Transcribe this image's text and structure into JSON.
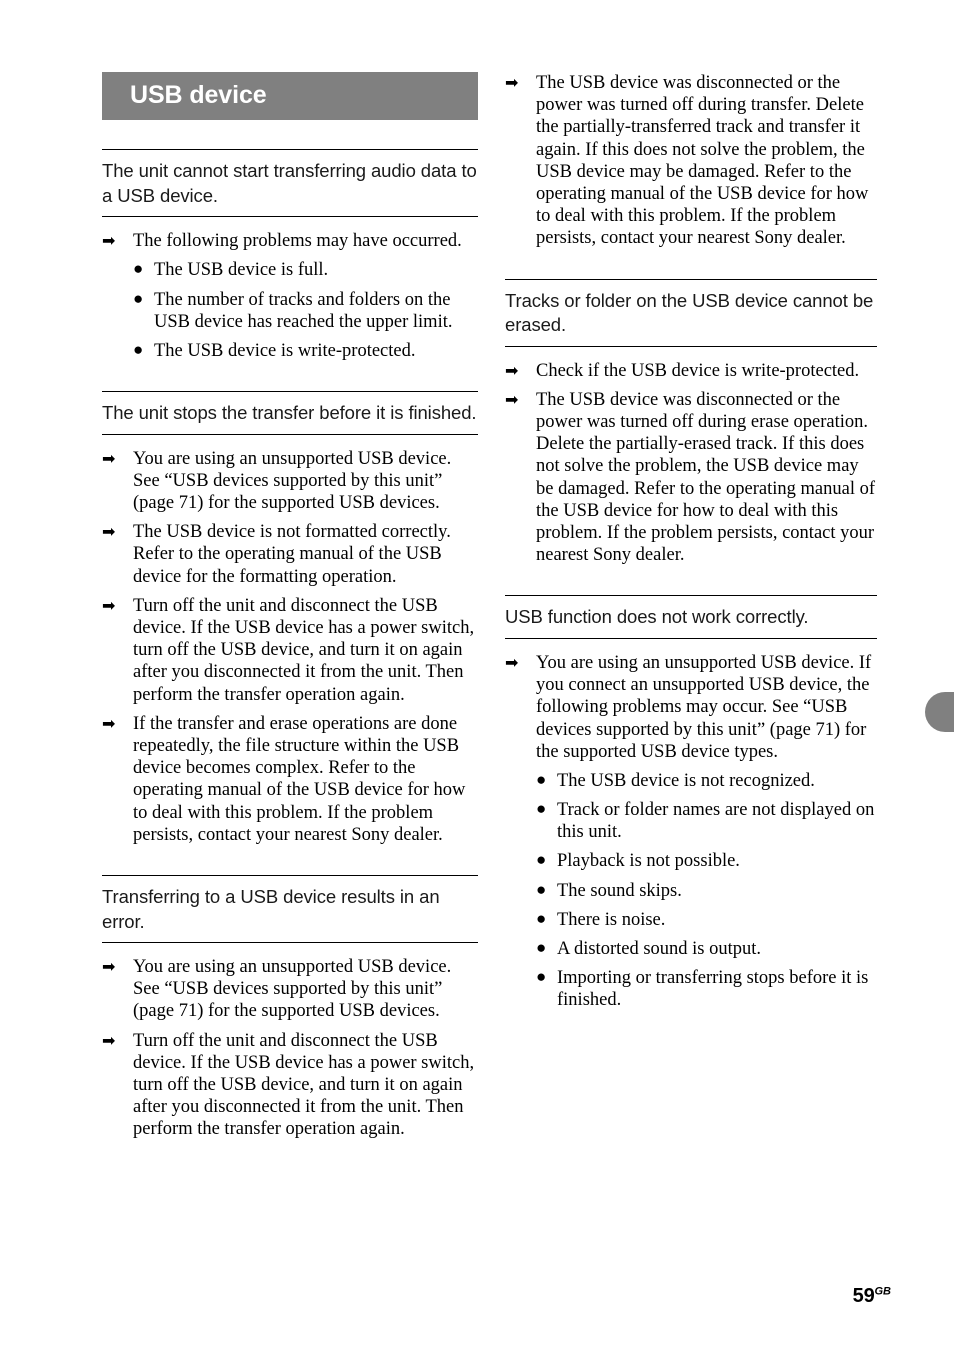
{
  "section": {
    "banner_title": "USB device"
  },
  "glyphs": {
    "arrow": "➡",
    "bullet": "●"
  },
  "left_column": {
    "blocks": [
      {
        "heading": "The unit cannot start transferring audio data to a USB device.",
        "items": [
          {
            "type": "arrow",
            "text": "The following problems may have occurred."
          },
          {
            "type": "bullet",
            "text": "The USB device is full."
          },
          {
            "type": "bullet",
            "text": "The number of tracks and folders on the USB device has reached the upper limit."
          },
          {
            "type": "bullet",
            "text": "The USB device is write-protected."
          }
        ]
      },
      {
        "heading": "The unit stops the transfer before it is finished.",
        "items": [
          {
            "type": "arrow",
            "text": "You are using an unsupported USB device. See “USB devices supported by this unit” (page 71) for the supported USB devices."
          },
          {
            "type": "arrow",
            "text": "The USB device is not formatted correctly. Refer to the operating manual of the USB device for the formatting operation."
          },
          {
            "type": "arrow",
            "text": "Turn off the unit and disconnect the USB device. If the USB device has a power switch, turn off the USB device, and turn it on again after you disconnected it from the unit. Then perform the transfer operation again."
          },
          {
            "type": "arrow",
            "text": "If the transfer and erase operations are done repeatedly, the file structure within the USB device becomes complex. Refer to the operating manual of the USB device for how to deal with this problem. If the problem persists, contact your nearest Sony dealer."
          }
        ]
      },
      {
        "heading": "Transferring to a USB device results in an error.",
        "items": [
          {
            "type": "arrow",
            "text": "You are using an unsupported USB device. See “USB devices supported by this unit” (page 71) for the supported USB devices."
          },
          {
            "type": "arrow",
            "text": "Turn off the unit and disconnect the USB device. If the USB device has a power switch, turn off the USB device, and turn it on again after you disconnected it from the unit. Then perform the transfer operation again."
          }
        ]
      }
    ]
  },
  "right_column": {
    "continued_items": [
      {
        "type": "arrow",
        "text": "The USB device was disconnected or the power was turned off during transfer. Delete the partially-transferred track and transfer it again. If this does not solve the problem, the USB device may be damaged. Refer to the operating manual of the USB device for how to deal with this problem. If the problem persists, contact your nearest Sony dealer."
      }
    ],
    "blocks": [
      {
        "heading": "Tracks or folder on the USB device cannot be erased.",
        "items": [
          {
            "type": "arrow",
            "text": "Check if the USB device is write-protected."
          },
          {
            "type": "arrow",
            "text": "The USB device was disconnected or the power was turned off during erase operation. Delete the partially-erased track. If this does not solve the problem, the USB device may be damaged. Refer to the operating manual of the USB device for how to deal with this problem. If the problem persists, contact your nearest Sony dealer."
          }
        ]
      },
      {
        "heading": "USB function does not work correctly.",
        "items": [
          {
            "type": "arrow",
            "text": "You are using an unsupported USB device. If you connect an unsupported USB device, the following problems may occur. See “USB devices supported by this unit” (page 71) for the supported USB device types."
          },
          {
            "type": "bullet",
            "text": "The USB device is not recognized."
          },
          {
            "type": "bullet",
            "text": "Track or folder names are not displayed on this unit."
          },
          {
            "type": "bullet",
            "text": "Playback is not possible."
          },
          {
            "type": "bullet",
            "text": "The sound skips."
          },
          {
            "type": "bullet",
            "text": "There is noise."
          },
          {
            "type": "bullet",
            "text": "A distorted sound is output."
          },
          {
            "type": "bullet",
            "text": "Importing or transferring stops before it is finished."
          }
        ]
      }
    ]
  },
  "footer": {
    "page_number": "59",
    "page_suffix": "GB"
  },
  "colors": {
    "banner_background": "#808080",
    "banner_text": "#ffffff",
    "thumb_tab": "#808080",
    "body_text": "#000000"
  }
}
